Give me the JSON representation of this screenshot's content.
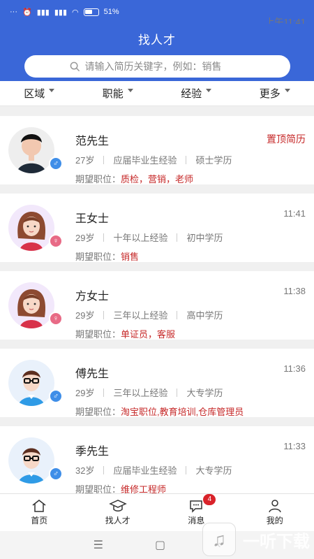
{
  "status_bar": {
    "time": "上午11:41",
    "dots": "···",
    "battery": "51%"
  },
  "header": {
    "title": "找人才"
  },
  "search": {
    "placeholder": "请输入简历关键字，例如：销售"
  },
  "filters": [
    "区域",
    "职能",
    "经验",
    "更多"
  ],
  "job_label": "期望职位：",
  "candidates": [
    {
      "name": "范先生",
      "age": "27岁",
      "experience": "应届毕业生经验",
      "education": "硕士学历",
      "jobs": "质检，营销，老师",
      "time": "置顶简历",
      "gender": "male",
      "avatar": "photo"
    },
    {
      "name": "王女士",
      "age": "29岁",
      "experience": "十年以上经验",
      "education": "初中学历",
      "jobs": "销售",
      "time": "11:41",
      "gender": "female",
      "avatar": "woman"
    },
    {
      "name": "方女士",
      "age": "29岁",
      "experience": "三年以上经验",
      "education": "高中学历",
      "jobs": "单证员，客服",
      "time": "11:38",
      "gender": "female",
      "avatar": "woman"
    },
    {
      "name": "傅先生",
      "age": "29岁",
      "experience": "三年以上经验",
      "education": "大专学历",
      "jobs": "淘宝职位,教育培训,仓库管理员",
      "time": "11:36",
      "gender": "male",
      "avatar": "man"
    },
    {
      "name": "季先生",
      "age": "32岁",
      "experience": "应届毕业生经验",
      "education": "大专学历",
      "jobs": "维修工程师",
      "time": "11:33",
      "gender": "male",
      "avatar": "man"
    }
  ],
  "tabs": [
    {
      "label": "首页",
      "icon": "home-icon"
    },
    {
      "label": "找人才",
      "icon": "graduation-cap-icon"
    },
    {
      "label": "消息",
      "icon": "chat-icon",
      "badge": "4"
    },
    {
      "label": "我的",
      "icon": "user-icon"
    }
  ],
  "watermark": {
    "text": "一听下载"
  },
  "colors": {
    "primary": "#3a67d8",
    "highlight": "#c62828",
    "male": "#3f8ee8",
    "female": "#e86a86"
  }
}
